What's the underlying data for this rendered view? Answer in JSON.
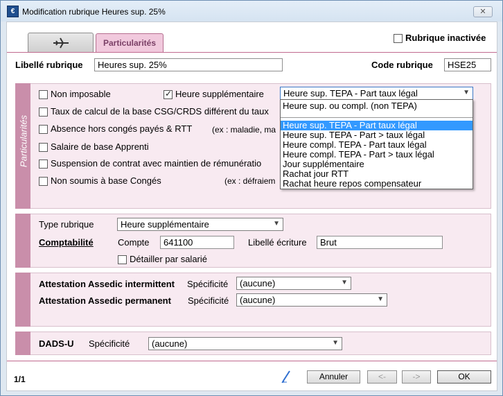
{
  "window": {
    "title": "Modification rubrique Heures sup. 25%",
    "close": "✕"
  },
  "tabs": {
    "second": "Particularités"
  },
  "inactive": {
    "label": "Rubrique inactivée",
    "checked": false
  },
  "header": {
    "libelle_label": "Libellé rubrique",
    "libelle_value": "Heures sup. 25%",
    "code_label": "Code rubrique",
    "code_value": "HSE25"
  },
  "particularites": {
    "side_label": "Particularités",
    "non_imposable": "Non imposable",
    "heure_sup": "Heure supplémentaire",
    "heure_sup_select": "Heure sup. TEPA - Part taux légal",
    "taux_csg": "Taux de calcul de la base CSG/CRDS différent du taux",
    "absence": "Absence hors congés payés & RTT",
    "absence_hint": "(ex : maladie, ma",
    "salaire_apprenti": "Salaire de base Apprenti",
    "suspension": "Suspension de contrat avec maintien de rémunératio",
    "non_soumis": "Non soumis à base Congés",
    "non_soumis_hint": "(ex : défraiem"
  },
  "dropdown": {
    "items": [
      "Heure sup. ou compl. (non TEPA)",
      "",
      "Heure sup. TEPA - Part taux légal",
      "Heure sup. TEPA - Part > taux légal",
      "Heure compl. TEPA - Part taux légal",
      "Heure compl. TEPA - Part > taux légal",
      "Jour supplémentaire",
      "Rachat jour RTT",
      "Rachat heure repos compensateur"
    ],
    "selected_index": 2
  },
  "type_section": {
    "type_label": "Type rubrique",
    "type_value": "Heure supplémentaire",
    "compta_label": "Comptabilité",
    "compte_label": "Compte",
    "compte_value": "641100",
    "libelle_ecriture_label": "Libellé écriture",
    "libelle_ecriture_value": "Brut",
    "detailler": "Détailler par salarié"
  },
  "assedic": {
    "intermittent_label": "Attestation Assedic intermittent",
    "permanent_label": "Attestation Assedic permanent",
    "specificite_label": "Spécificité",
    "intermittent_value": "(aucune)",
    "permanent_value": "(aucune)"
  },
  "dads": {
    "label": "DADS-U",
    "specificite_label": "Spécificité",
    "value": "(aucune)"
  },
  "footer": {
    "pager": "1/1",
    "cancel": "Annuler",
    "prev": "<-",
    "next": "->",
    "ok": "OK"
  }
}
